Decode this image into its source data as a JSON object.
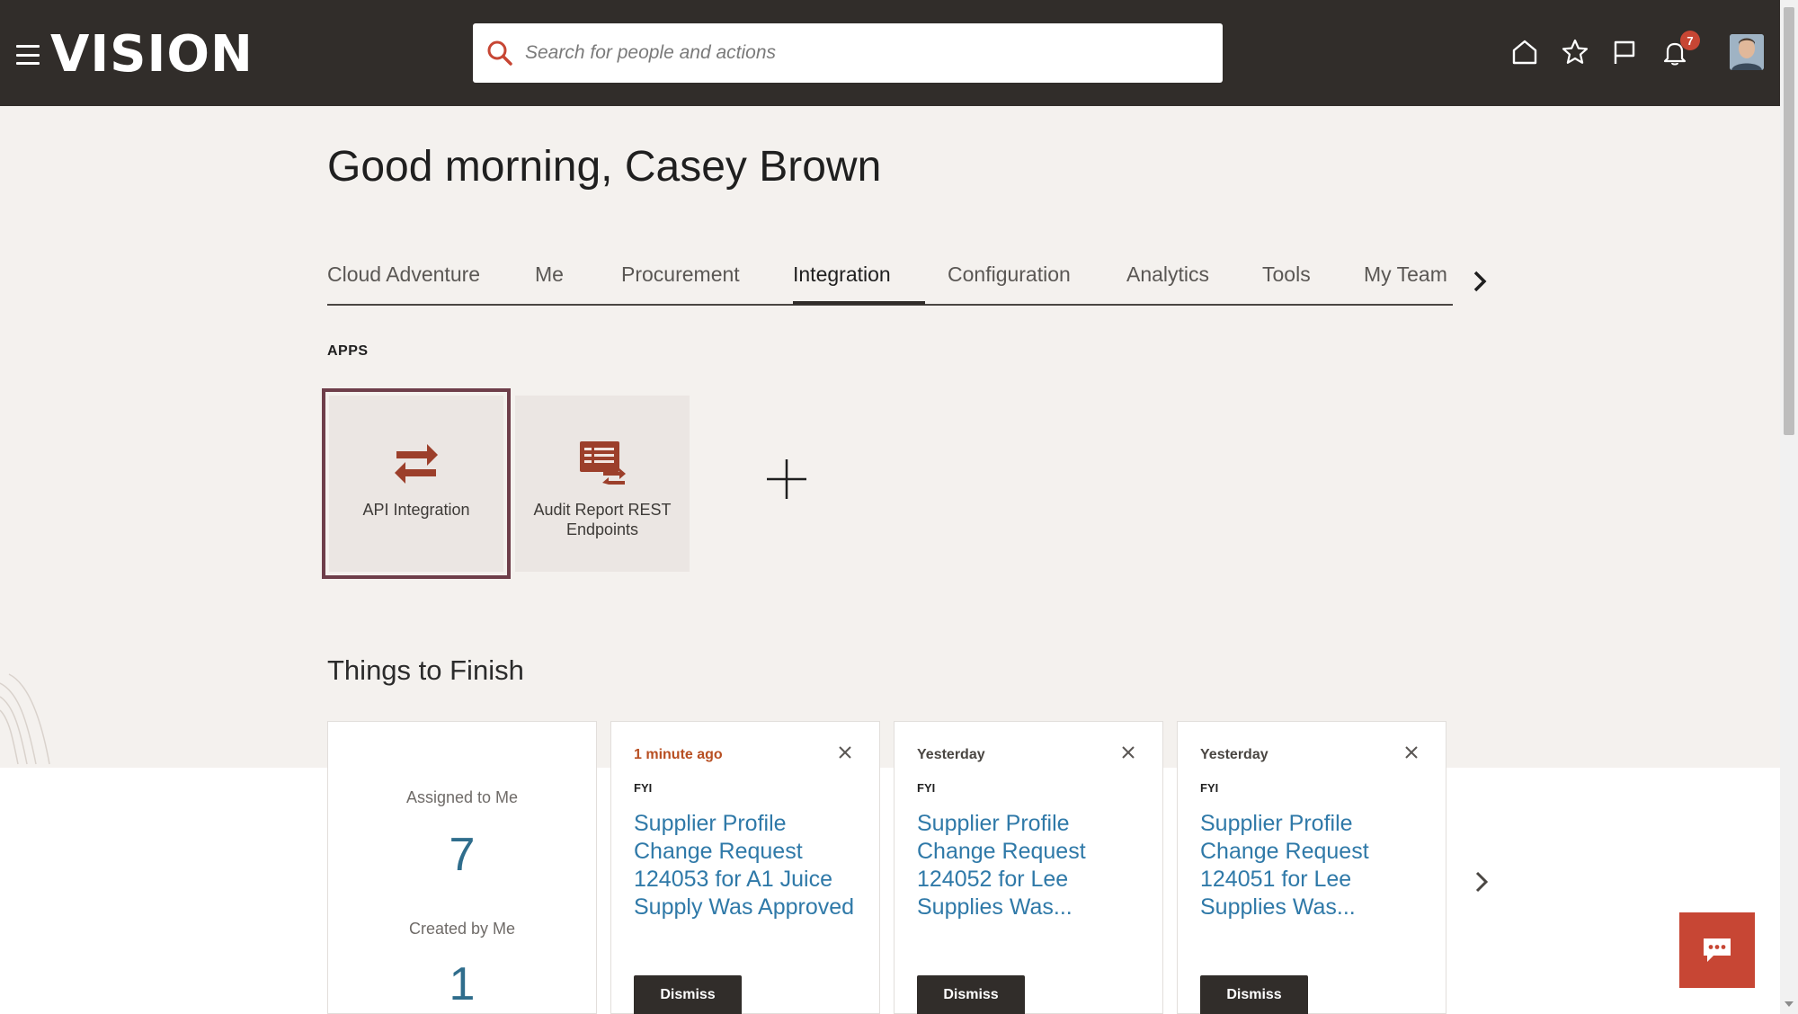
{
  "header": {
    "logo": "VISION",
    "search_placeholder": "Search for people and actions",
    "notification_count": "7",
    "icons": [
      "menu-icon",
      "home-icon",
      "star-icon",
      "flag-icon",
      "bell-icon",
      "user-avatar"
    ]
  },
  "greeting": "Good morning, Casey Brown",
  "tabs": [
    {
      "label": "Cloud Adventure"
    },
    {
      "label": "Me"
    },
    {
      "label": "Procurement"
    },
    {
      "label": "Integration",
      "active": true
    },
    {
      "label": "Configuration"
    },
    {
      "label": "Analytics"
    },
    {
      "label": "Tools"
    },
    {
      "label": "My Team"
    }
  ],
  "apps": {
    "label": "APPS",
    "items": [
      {
        "label": "API Integration",
        "icon": "transfer-arrows-icon",
        "selected": true
      },
      {
        "label": "Audit Report REST Endpoints",
        "icon": "report-transfer-icon"
      }
    ]
  },
  "things_to_finish": {
    "title": "Things to Finish",
    "summary": {
      "assigned_label": "Assigned to Me",
      "assigned_count": "7",
      "created_label": "Created by Me",
      "created_count": "1"
    },
    "cards": [
      {
        "time": "1 minute ago",
        "type": "FYI",
        "title": "Supplier Profile Change Request 124053 for A1 Juice Supply Was Approved",
        "action": "Dismiss"
      },
      {
        "time": "Yesterday",
        "type": "FYI",
        "title": "Supplier Profile Change Request 124052 for Lee Supplies Was...",
        "action": "Dismiss"
      },
      {
        "time": "Yesterday",
        "type": "FYI",
        "title": "Supplier Profile Change Request 124051 for Lee Supplies Was...",
        "action": "Dismiss"
      }
    ]
  },
  "colors": {
    "header_bg": "#312d2a",
    "accent": "#c74634",
    "link": "#2f79a8",
    "page_bg": "#f4f1ee"
  }
}
